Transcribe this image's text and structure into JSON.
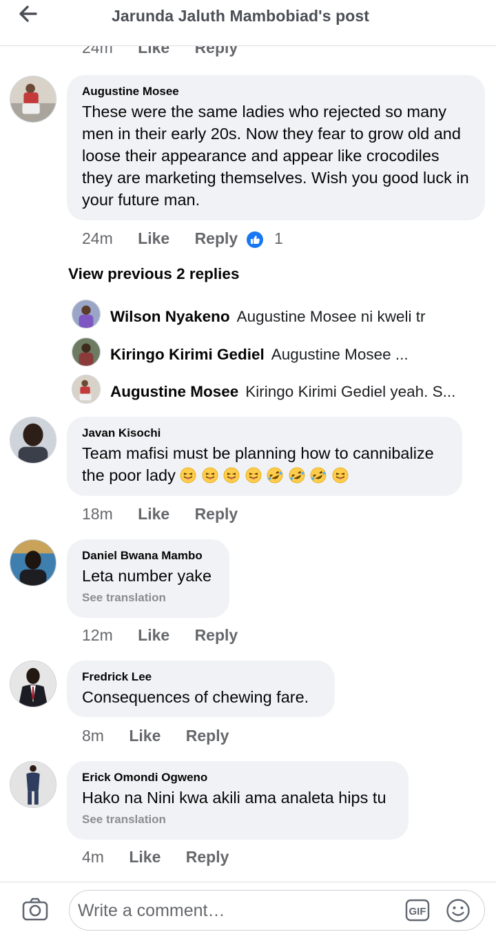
{
  "header": {
    "title": "Jarunda Jaluth Mambobiad's post",
    "back_icon": "back-arrow-icon"
  },
  "actions": {
    "like": "Like",
    "reply": "Reply"
  },
  "top_partial": {
    "time": "24m"
  },
  "comments": [
    {
      "author": "Augustine Mosee",
      "text": "These were the same ladies who rejected so many men in their early 20s. Now they fear to grow old and loose their appearance and appear like crocodiles they are marketing themselves. Wish you good luck in your future man.",
      "time": "24m",
      "reactions": {
        "icon": "like-reaction-icon",
        "count": "1"
      }
    },
    {
      "author": "Javan Kisochi",
      "text": "Team mafisi must be planning how to cannibalize the poor lady",
      "emojis": [
        "tongue-out-icon",
        "tongue-out-icon",
        "tongue-out-icon",
        "tongue-out-icon",
        "rofl-icon",
        "rofl-icon",
        "rofl-icon",
        "tongue-out-icon"
      ],
      "time": "18m"
    },
    {
      "author": "Daniel Bwana Mambo",
      "text": "Leta number yake",
      "see_translation": "See translation",
      "time": "12m"
    },
    {
      "author": "Fredrick Lee",
      "text": "Consequences of chewing fare.",
      "time": "8m"
    },
    {
      "author": "Erick Omondi Ogweno",
      "text": "Hako na Nini kwa akili ama analeta hips tu",
      "see_translation": "See translation",
      "time": "4m"
    }
  ],
  "view_previous": "View previous 2 replies",
  "replies": [
    {
      "author": "Wilson Nyakeno",
      "text": "Augustine Mosee ni kweli tr"
    },
    {
      "author": "Kiringo Kirimi Gediel",
      "text": "Augustine Mosee ..."
    },
    {
      "author": "Augustine Mosee",
      "text": "Kiringo Kirimi Gediel yeah. S..."
    }
  ],
  "composer": {
    "placeholder": "Write a comment…",
    "camera_icon": "camera-icon",
    "gif_icon": "gif-icon",
    "emoji_icon": "smiley-icon"
  },
  "colors": {
    "bubble": "#f0f2f5",
    "meta_text": "#65676b",
    "like_blue": "#1877f2",
    "divider": "#dadde1"
  }
}
